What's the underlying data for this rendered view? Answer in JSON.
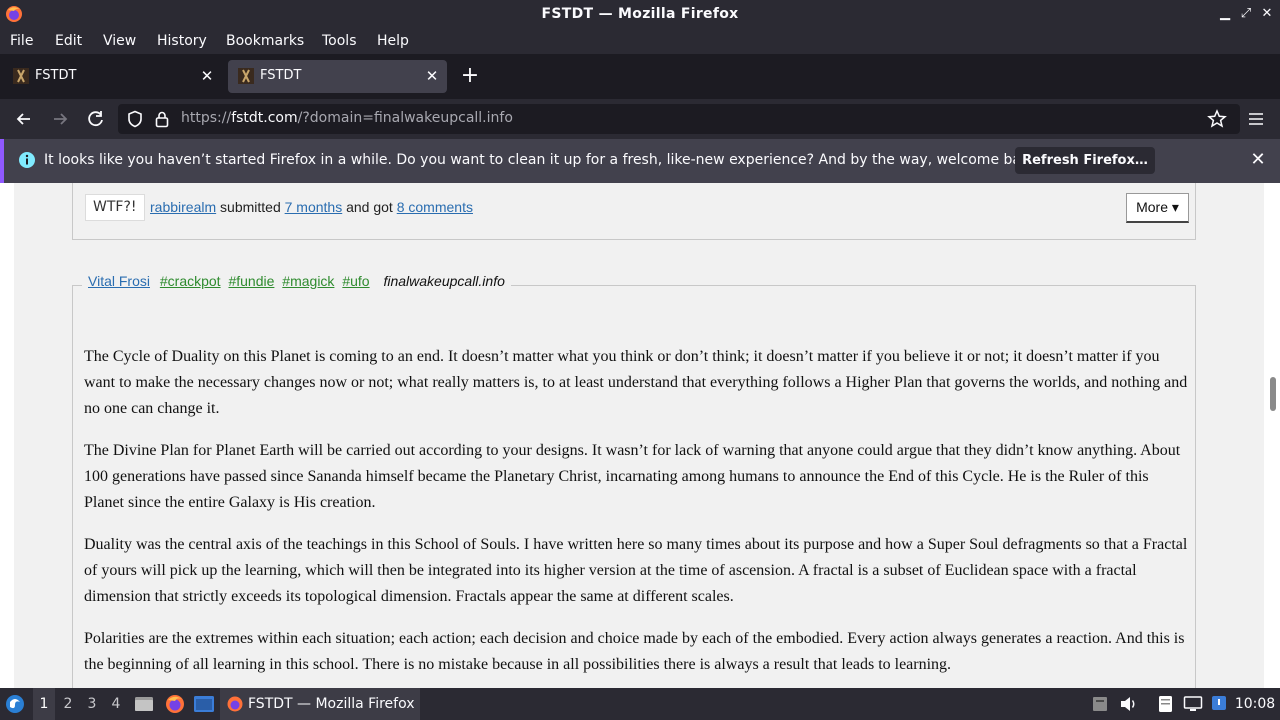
{
  "window": {
    "title": "FSTDT — Mozilla Firefox"
  },
  "menu": [
    "File",
    "Edit",
    "View",
    "History",
    "Bookmarks",
    "Tools",
    "Help"
  ],
  "tabs": [
    {
      "label": "FSTDT"
    },
    {
      "label": "FSTDT"
    }
  ],
  "url": {
    "prefix": "https://",
    "host": "fstdt.com",
    "rest": "/?domain=finalwakeupcall.info"
  },
  "infobar": {
    "message": "It looks like you haven’t started Firefox in a while. Do you want to clean it up for a fresh, like-new experience? And by the way, welcome back!",
    "button": "Refresh Firefox…"
  },
  "prev_post": {
    "wtf": "WTF?!",
    "user": "rabbirealm",
    "submitted": "submitted",
    "time": "7 months",
    "and_got": "and got",
    "comments": "8 comments",
    "more": "More ▾"
  },
  "post": {
    "author": "Vital Frosi",
    "tags": [
      "#crackpot",
      "#fundie",
      "#magick",
      "#ufo"
    ],
    "domain": "finalwakeupcall.info",
    "paragraphs": [
      "The Cycle of Duality on this Planet is coming to an end. It doesn’t matter what you think or don’t think; it doesn’t matter if you believe it or not; it doesn’t matter if you want to make the necessary changes now or not; what really matters is, to at least understand that everything follows a Higher Plan that governs the worlds, and nothing and no one can change it.",
      "The Divine Plan for Planet Earth will be carried out according to your designs. It wasn’t for lack of warning that anyone could argue that they didn’t know anything. About 100 generations have passed since Sananda himself became the Planetary Christ, incarnating among humans to announce the End of this Cycle. He is the Ruler of this Planet since the entire Galaxy is His creation.",
      "Duality was the central axis of the teachings in this School of Souls. I have written here so many times about its purpose and how a Super Soul defragments so that a Fractal of yours will pick up the learning, which will then be integrated into its higher version at the time of ascension. A fractal is a subset of Euclidean space with a fractal dimension that strictly exceeds its topological dimension. Fractals appear the same at different scales.",
      "Polarities are the extremes within each situation; each action; each decision and choice made by each of the embodied. Every action always generates a reaction. And this is the beginning of all learning in this school. There is no mistake because in all possibilities there is always a result that leads to learning."
    ]
  },
  "taskbar": {
    "workspaces": [
      "1",
      "2",
      "3",
      "4"
    ],
    "active_window": "FSTDT — Mozilla Firefox",
    "clock": "10:08"
  },
  "colors": {
    "accent": "#9059ff",
    "link": "#2a6db0",
    "tag": "#2e8b2e"
  }
}
